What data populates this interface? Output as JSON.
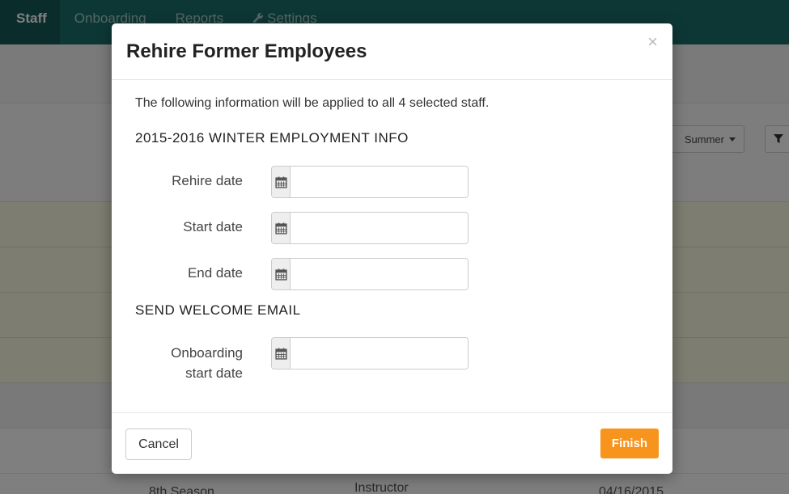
{
  "nav": {
    "items": [
      {
        "label": "Staff",
        "active": true
      },
      {
        "label": "Onboarding",
        "active": false
      },
      {
        "label": "Reports",
        "active": false
      },
      {
        "label": "Settings",
        "active": false,
        "icon": "wrench-icon"
      }
    ]
  },
  "background": {
    "season_filter_label": "Summer",
    "filter_icon": "filter-icon",
    "bottom_row": {
      "season": "8th Season",
      "role": "Instructor",
      "date": "04/16/2015"
    }
  },
  "modal": {
    "title": "Rehire Former Employees",
    "close_symbol": "×",
    "intro": "The following information will be applied to all 4 selected staff.",
    "employment_section": {
      "title": "2015-2016 WINTER EMPLOYMENT INFO",
      "fields": [
        {
          "label": "Rehire date",
          "value": "",
          "icon": "calendar-icon"
        },
        {
          "label": "Start date",
          "value": "",
          "icon": "calendar-icon"
        },
        {
          "label": "End date",
          "value": "",
          "icon": "calendar-icon"
        }
      ]
    },
    "email_section": {
      "title": "SEND WELCOME EMAIL",
      "fields": [
        {
          "label_line1": "Onboarding",
          "label_line2": "start date",
          "value": "",
          "icon": "calendar-icon"
        }
      ]
    },
    "footer": {
      "cancel_label": "Cancel",
      "finish_label": "Finish"
    }
  },
  "colors": {
    "nav_bg": "#1b6e6a",
    "nav_active_bg": "#155b57",
    "finish_button": "#f7941d",
    "row_highlight": "#fbfbe2"
  }
}
